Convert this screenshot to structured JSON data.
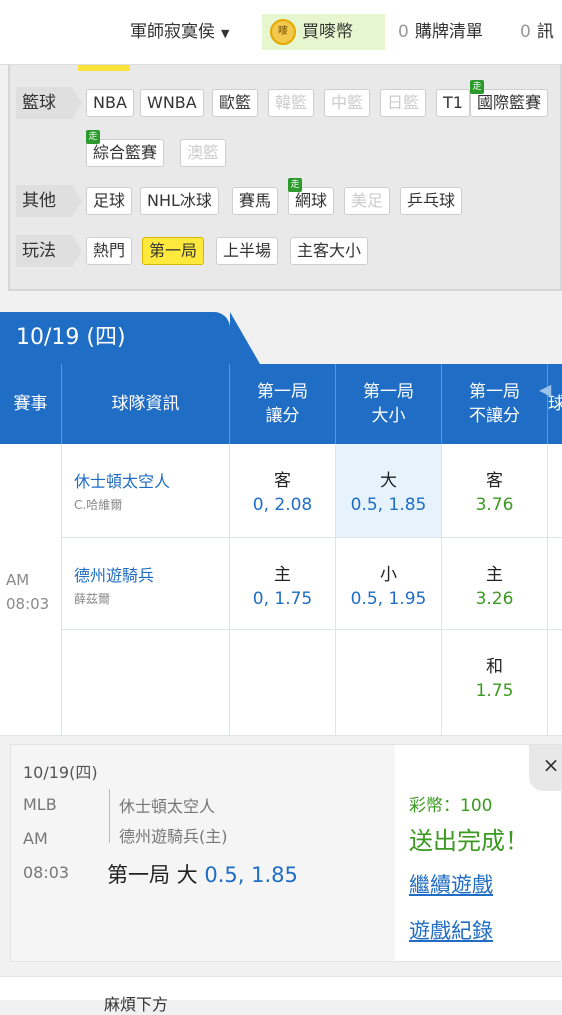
{
  "header": {
    "user_label": "軍師寂寞侯",
    "buy_label": "買嘜幣",
    "coin_text": "嘜",
    "list_count": "0",
    "list_label": "購牌清單",
    "msg_count": "0",
    "msg_label": "訊"
  },
  "filters": {
    "basketball": {
      "label": "籃球",
      "chips": [
        "NBA",
        "WNBA",
        "歐籃",
        "韓籃",
        "中籃",
        "日籃",
        "T1",
        "國際籃賽",
        "綜合籃賽",
        "澳籃"
      ]
    },
    "other": {
      "label": "其他",
      "chips": [
        "足球",
        "NHL冰球",
        "賽馬",
        "網球",
        "美足",
        "乒乓球"
      ]
    },
    "play": {
      "label": "玩法",
      "chips": [
        "熱門",
        "第一局",
        "上半場",
        "主客大小"
      ]
    },
    "live_badge": "走"
  },
  "table": {
    "date": "10/19 (四)",
    "headers": {
      "event": "賽事",
      "team_info": "球隊資訊",
      "h1_1": "第一局",
      "h1_2": "讓分",
      "h2_1": "第一局",
      "h2_2": "大小",
      "h3_1": "第一局",
      "h3_2": "不讓分",
      "h4": "球"
    },
    "time_1": "AM",
    "time_2": "08:03",
    "away": {
      "team": "休士頓太空人",
      "pitcher": "C.哈維爾"
    },
    "home": {
      "team": "德州遊騎兵",
      "pitcher": "薛茲爾"
    },
    "rows": [
      {
        "spread_side": "客",
        "spread_val": "0, 2.08",
        "total_side": "大",
        "total_val": "0.5, 1.85",
        "ml_side": "客",
        "ml_val": "3.76"
      },
      {
        "spread_side": "主",
        "spread_val": "0, 1.75",
        "total_side": "小",
        "total_val": "0.5, 1.95",
        "ml_side": "主",
        "ml_val": "3.26"
      },
      {
        "ml_side": "和",
        "ml_val": "1.75"
      }
    ]
  },
  "slip": {
    "date": "10/19(四)",
    "league": "MLB",
    "time_1": "AM",
    "time_2": "08:03",
    "away": "休士頓太空人",
    "home": "德州遊騎兵(主)",
    "pick_label": "第一局 大",
    "pick_value": "0.5, 1.85",
    "coins": "彩幣：100",
    "status": "送出完成！",
    "continue_link": "繼續遊戲",
    "history_link": "遊戲紀錄",
    "close": "×"
  },
  "bottom": {
    "text": "麻煩下方"
  }
}
